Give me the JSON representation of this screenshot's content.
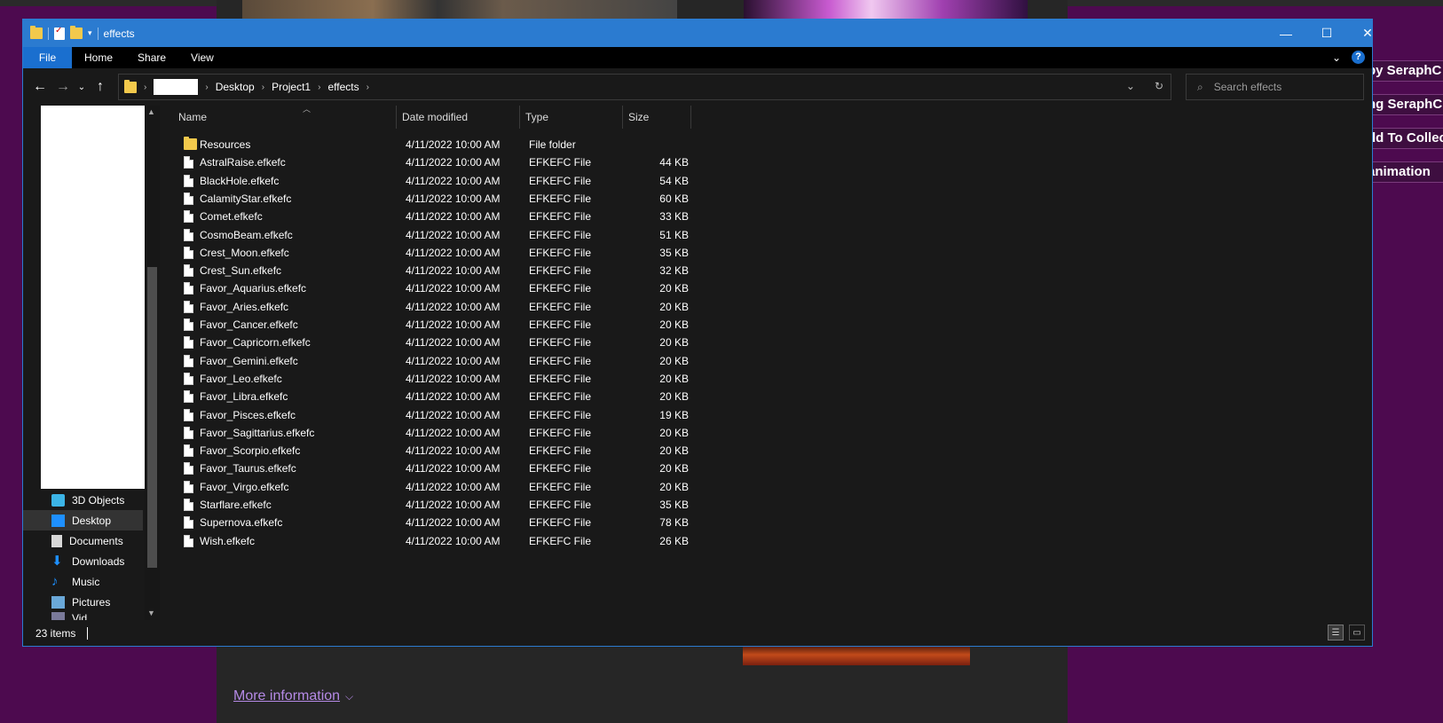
{
  "background": {
    "more_info_label": "More information",
    "side_pills": [
      "by SeraphC",
      "ng SeraphC",
      "dd To Collec",
      "animation"
    ]
  },
  "window": {
    "title": "effects",
    "controls": {
      "minimize": "—",
      "maximize": "☐",
      "close": "✕"
    }
  },
  "ribbon": {
    "tabs": [
      "File",
      "Home",
      "Share",
      "View"
    ],
    "help_label": "?"
  },
  "address": {
    "crumbs": [
      "Desktop",
      "Project1",
      "effects"
    ]
  },
  "search": {
    "placeholder": "Search effects"
  },
  "nav_pane": {
    "items": [
      {
        "label": "3D Objects",
        "icon": "3d-objects-icon",
        "selected": false
      },
      {
        "label": "Desktop",
        "icon": "desktop-icon",
        "selected": true
      },
      {
        "label": "Documents",
        "icon": "documents-icon",
        "selected": false
      },
      {
        "label": "Downloads",
        "icon": "downloads-icon",
        "selected": false
      },
      {
        "label": "Music",
        "icon": "music-icon",
        "selected": false
      },
      {
        "label": "Pictures",
        "icon": "pictures-icon",
        "selected": false
      },
      {
        "label": "Vid",
        "icon": "videos-icon",
        "selected": false
      }
    ]
  },
  "columns": {
    "name": "Name",
    "date": "Date modified",
    "type": "Type",
    "size": "Size"
  },
  "files": [
    {
      "name": "Resources",
      "date": "4/11/2022 10:00 AM",
      "type": "File folder",
      "size": "",
      "folder": true
    },
    {
      "name": "AstralRaise.efkefc",
      "date": "4/11/2022 10:00 AM",
      "type": "EFKEFC File",
      "size": "44 KB"
    },
    {
      "name": "BlackHole.efkefc",
      "date": "4/11/2022 10:00 AM",
      "type": "EFKEFC File",
      "size": "54 KB"
    },
    {
      "name": "CalamityStar.efkefc",
      "date": "4/11/2022 10:00 AM",
      "type": "EFKEFC File",
      "size": "60 KB"
    },
    {
      "name": "Comet.efkefc",
      "date": "4/11/2022 10:00 AM",
      "type": "EFKEFC File",
      "size": "33 KB"
    },
    {
      "name": "CosmoBeam.efkefc",
      "date": "4/11/2022 10:00 AM",
      "type": "EFKEFC File",
      "size": "51 KB"
    },
    {
      "name": "Crest_Moon.efkefc",
      "date": "4/11/2022 10:00 AM",
      "type": "EFKEFC File",
      "size": "35 KB"
    },
    {
      "name": "Crest_Sun.efkefc",
      "date": "4/11/2022 10:00 AM",
      "type": "EFKEFC File",
      "size": "32 KB"
    },
    {
      "name": "Favor_Aquarius.efkefc",
      "date": "4/11/2022 10:00 AM",
      "type": "EFKEFC File",
      "size": "20 KB"
    },
    {
      "name": "Favor_Aries.efkefc",
      "date": "4/11/2022 10:00 AM",
      "type": "EFKEFC File",
      "size": "20 KB"
    },
    {
      "name": "Favor_Cancer.efkefc",
      "date": "4/11/2022 10:00 AM",
      "type": "EFKEFC File",
      "size": "20 KB"
    },
    {
      "name": "Favor_Capricorn.efkefc",
      "date": "4/11/2022 10:00 AM",
      "type": "EFKEFC File",
      "size": "20 KB"
    },
    {
      "name": "Favor_Gemini.efkefc",
      "date": "4/11/2022 10:00 AM",
      "type": "EFKEFC File",
      "size": "20 KB"
    },
    {
      "name": "Favor_Leo.efkefc",
      "date": "4/11/2022 10:00 AM",
      "type": "EFKEFC File",
      "size": "20 KB"
    },
    {
      "name": "Favor_Libra.efkefc",
      "date": "4/11/2022 10:00 AM",
      "type": "EFKEFC File",
      "size": "20 KB"
    },
    {
      "name": "Favor_Pisces.efkefc",
      "date": "4/11/2022 10:00 AM",
      "type": "EFKEFC File",
      "size": "19 KB"
    },
    {
      "name": "Favor_Sagittarius.efkefc",
      "date": "4/11/2022 10:00 AM",
      "type": "EFKEFC File",
      "size": "20 KB"
    },
    {
      "name": "Favor_Scorpio.efkefc",
      "date": "4/11/2022 10:00 AM",
      "type": "EFKEFC File",
      "size": "20 KB"
    },
    {
      "name": "Favor_Taurus.efkefc",
      "date": "4/11/2022 10:00 AM",
      "type": "EFKEFC File",
      "size": "20 KB"
    },
    {
      "name": "Favor_Virgo.efkefc",
      "date": "4/11/2022 10:00 AM",
      "type": "EFKEFC File",
      "size": "20 KB"
    },
    {
      "name": "Starflare.efkefc",
      "date": "4/11/2022 10:00 AM",
      "type": "EFKEFC File",
      "size": "35 KB"
    },
    {
      "name": "Supernova.efkefc",
      "date": "4/11/2022 10:00 AM",
      "type": "EFKEFC File",
      "size": "78 KB"
    },
    {
      "name": "Wish.efkefc",
      "date": "4/11/2022 10:00 AM",
      "type": "EFKEFC File",
      "size": "26 KB"
    }
  ],
  "status": {
    "item_count": "23 items"
  },
  "colors": {
    "title_bar": "#2b7bd0",
    "window_bg": "#191919",
    "page_bg": "#4d0a4f",
    "folder": "#f2c94c"
  }
}
